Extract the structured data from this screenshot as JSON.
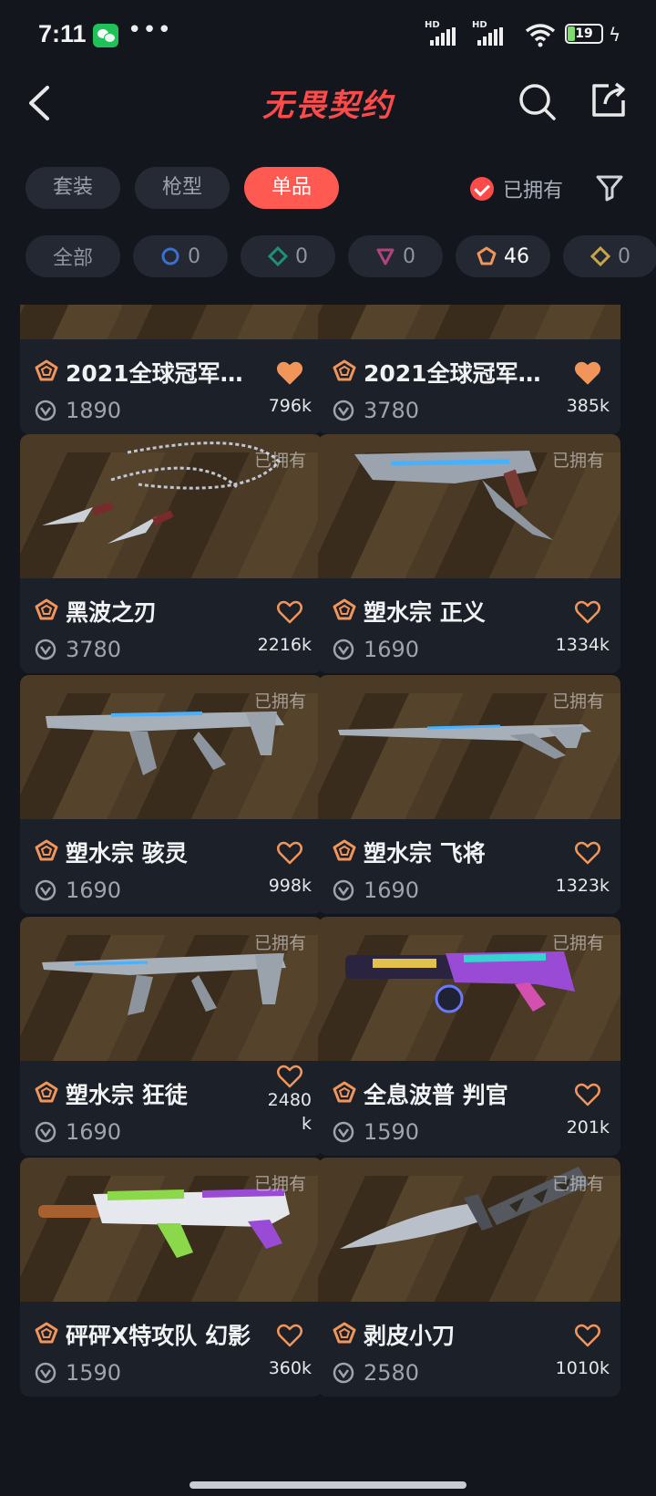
{
  "status_bar": {
    "time": "7:11",
    "battery": "19",
    "signal_label": "HD"
  },
  "header": {
    "logo": "无畏契约",
    "back_icon": "back-arrow-icon",
    "search_icon": "search-icon",
    "share_icon": "share-icon"
  },
  "tabs": [
    {
      "label": "套装",
      "active": false
    },
    {
      "label": "枪型",
      "active": false
    },
    {
      "label": "单品",
      "active": true
    }
  ],
  "owned_filter": {
    "label": "已拥有",
    "checked": true
  },
  "rarity_chips": [
    {
      "label": "全部",
      "count": null,
      "icon": "all"
    },
    {
      "label": "",
      "count": "0",
      "icon": "circle-tier-icon",
      "color": "#3b6fd0"
    },
    {
      "label": "",
      "count": "0",
      "icon": "diamond-tier-icon",
      "color": "#1f8f77"
    },
    {
      "label": "",
      "count": "0",
      "icon": "triangle-tier-icon",
      "color": "#b0447e"
    },
    {
      "label": "",
      "count": "46",
      "icon": "pentagon-tier-icon",
      "color": "#f2955a"
    },
    {
      "label": "",
      "count": "0",
      "icon": "diamond-gold-tier-icon",
      "color": "#c9a54a"
    }
  ],
  "cards": [
    {
      "name": "2021全球冠军…",
      "price": "1890",
      "likes": "796k",
      "liked": true,
      "owned": "",
      "gun": "partial"
    },
    {
      "name": "2021全球冠军…",
      "price": "3780",
      "likes": "385k",
      "liked": true,
      "owned": "",
      "gun": "partial"
    },
    {
      "name": "黑波之刃",
      "price": "3780",
      "likes": "2216k",
      "liked": false,
      "owned": "已拥有",
      "gun": "kunai"
    },
    {
      "name": "塑水宗 正义",
      "price": "1690",
      "likes": "1334k",
      "liked": false,
      "owned": "已拥有",
      "gun": "pistol"
    },
    {
      "name": "塑水宗 骇灵",
      "price": "1690",
      "likes": "998k",
      "liked": false,
      "owned": "已拥有",
      "gun": "rifle"
    },
    {
      "name": "塑水宗 飞将",
      "price": "1690",
      "likes": "1323k",
      "liked": false,
      "owned": "已拥有",
      "gun": "sniper"
    },
    {
      "name": "塑水宗 狂徒",
      "price": "1690",
      "likes": "2480\nk",
      "liked": false,
      "owned": "已拥有",
      "gun": "rifle2"
    },
    {
      "name": "全息波普 判官",
      "price": "1590",
      "likes": "201k",
      "liked": false,
      "owned": "已拥有",
      "gun": "shotgun"
    },
    {
      "name": "砰砰X特攻队 幻影",
      "price": "1590",
      "likes": "360k",
      "liked": false,
      "owned": "已拥有",
      "gun": "phantom"
    },
    {
      "name": "剥皮小刀",
      "price": "2580",
      "likes": "1010k",
      "liked": false,
      "owned": "已拥有",
      "gun": "knife"
    }
  ]
}
